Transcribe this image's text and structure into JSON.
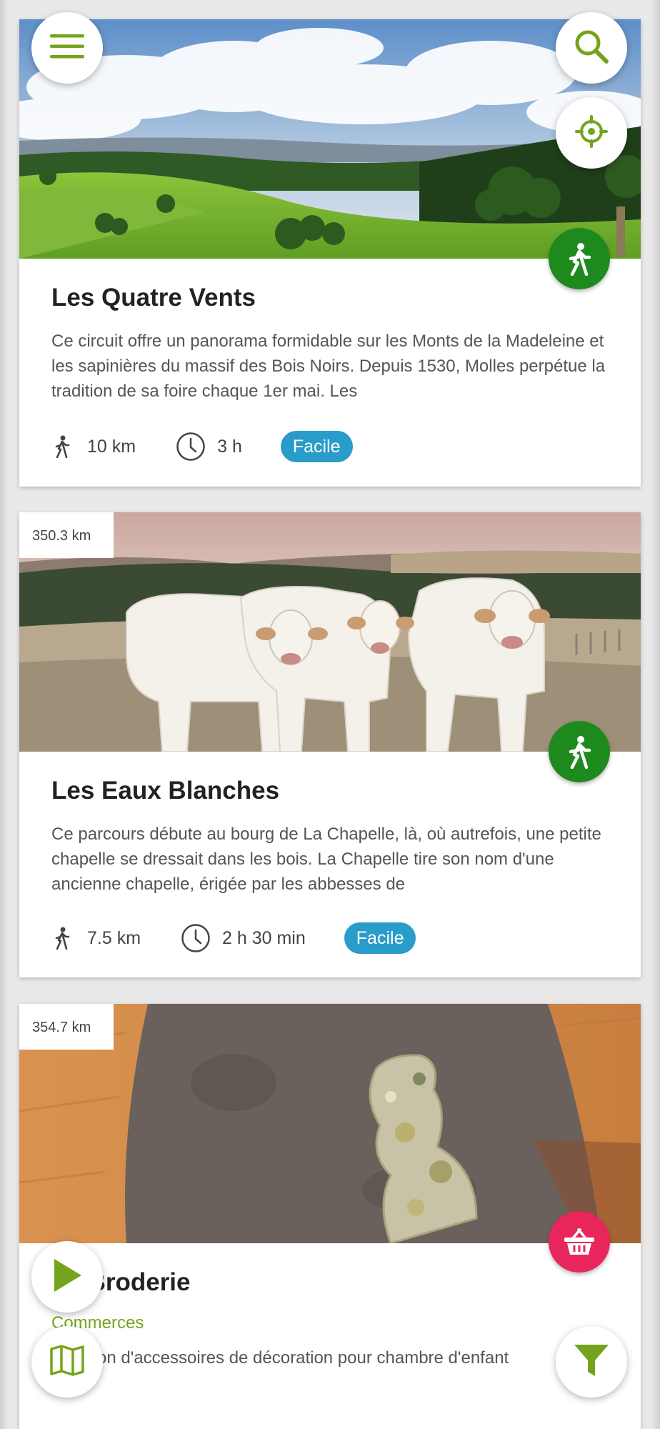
{
  "colors": {
    "accent": "#74a41d",
    "walk_green": "#1e8a1e",
    "shop_pink": "#e8265c",
    "level_blue": "#2a9cc9"
  },
  "fabs": {
    "menu": "menu-icon",
    "search": "search-icon",
    "locate": "crosshair-icon",
    "play": "play-icon",
    "map": "map-icon",
    "filter": "filter-icon"
  },
  "cards": [
    {
      "title": "Les Quatre Vents",
      "description": "Ce circuit offre un panorama formidable sur les Monts de la Madeleine et les sapinières du massif des Bois Noirs. Depuis 1530, Molles perpétue la tradition de sa foire chaque 1er mai. Les",
      "length": "10 km",
      "duration": "3 h",
      "level": "Facile",
      "practice_icon": "hiking-icon"
    },
    {
      "distance": "350.3 km",
      "title": "Les Eaux Blanches",
      "description": "Ce parcours débute au bourg de La Chapelle, là, où autrefois, une petite chapelle se dressait dans les bois. La Chapelle tire son nom d'une ancienne chapelle, érigée par les abbesses de",
      "length": "7.5 km",
      "duration": "2 h 30 min",
      "level": "Facile",
      "practice_icon": "hiking-icon"
    },
    {
      "distance": "354.7 km",
      "title": "La Broderie",
      "category": "Commerces",
      "description": "Création d'accessoires de décoration pour chambre d'enfant",
      "practice_icon": "shopping-basket-icon"
    }
  ]
}
